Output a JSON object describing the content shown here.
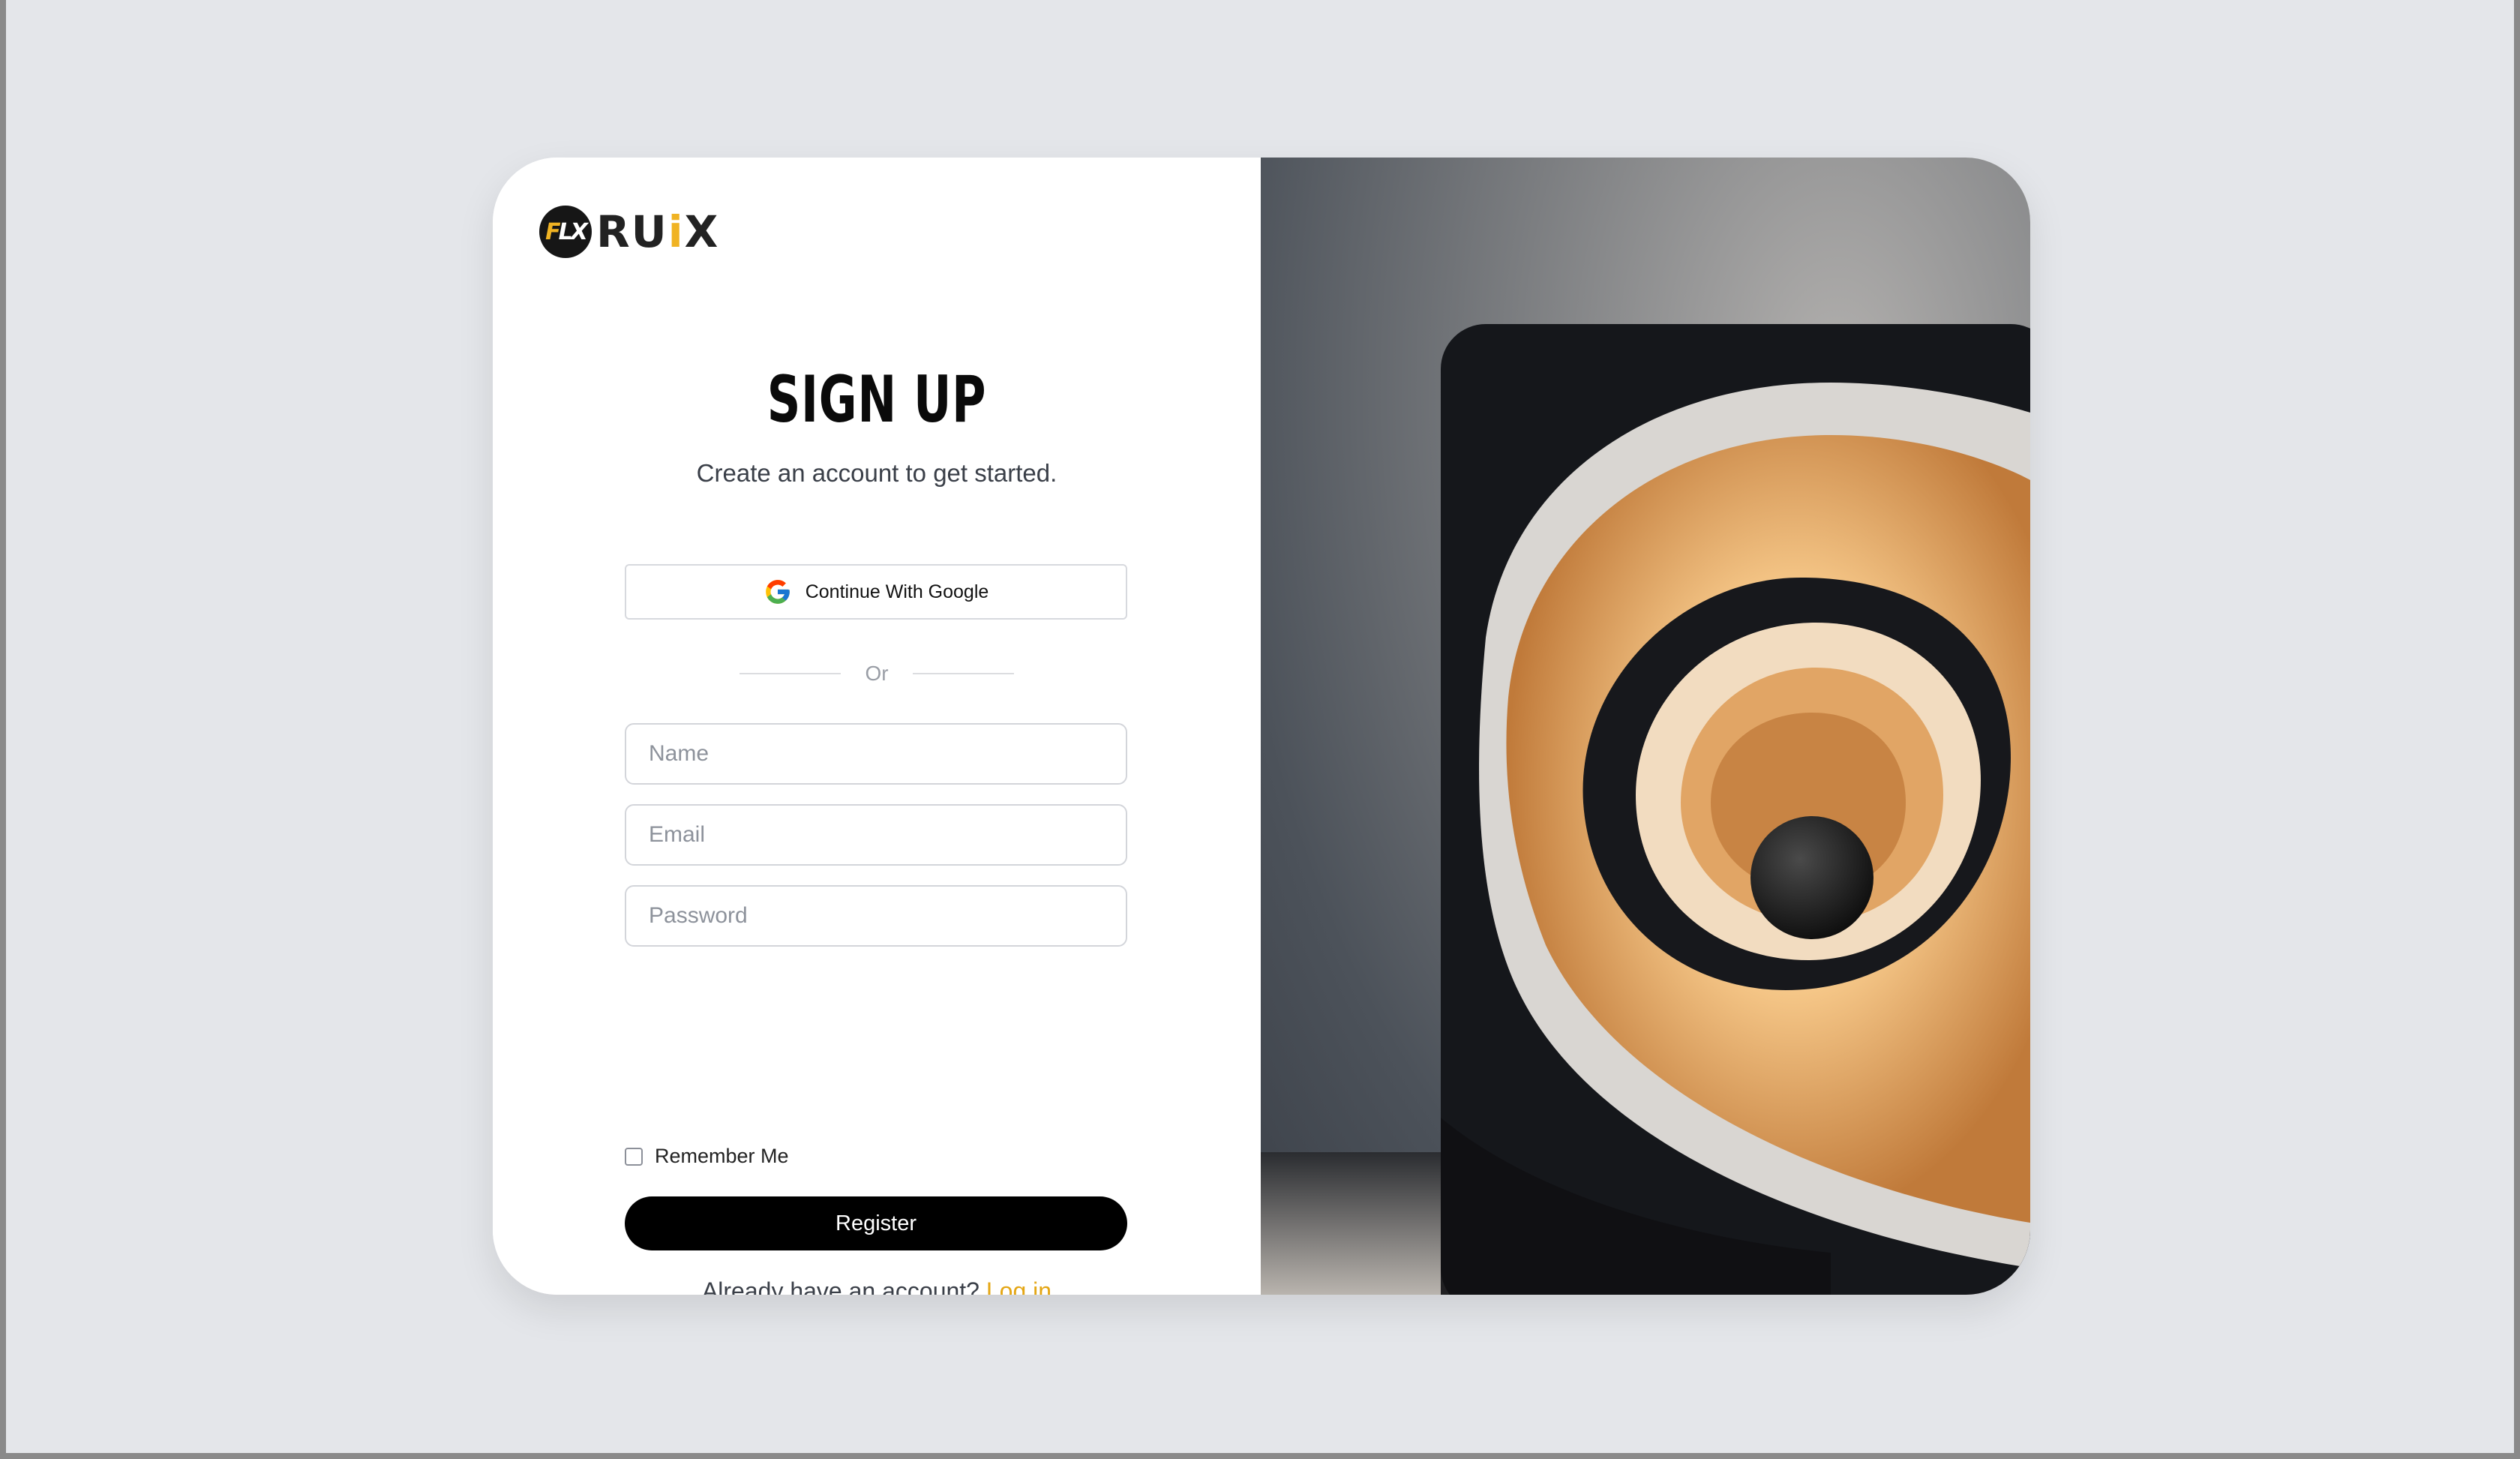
{
  "brand": {
    "mark_letters": [
      "F",
      "LX"
    ],
    "wordmark_parts": [
      "RU",
      "i",
      "X"
    ]
  },
  "form": {
    "title": "SIGN UP",
    "subtitle": "Create an account to get started.",
    "google_button": "Continue With Google",
    "divider": "Or",
    "name_placeholder": "Name",
    "email_placeholder": "Email",
    "password_placeholder": "Password",
    "remember_label": "Remember Me",
    "remember_checked": false,
    "register_button": "Register",
    "login_prompt": "Already have an account?",
    "login_link": "Log in"
  },
  "colors": {
    "accent": "#f0b323",
    "link": "#e4a614",
    "button": "#000000",
    "background": "#e4e6ea"
  },
  "icons": {
    "google": "google-logo-icon",
    "checkbox": "checkbox-unchecked-icon"
  }
}
